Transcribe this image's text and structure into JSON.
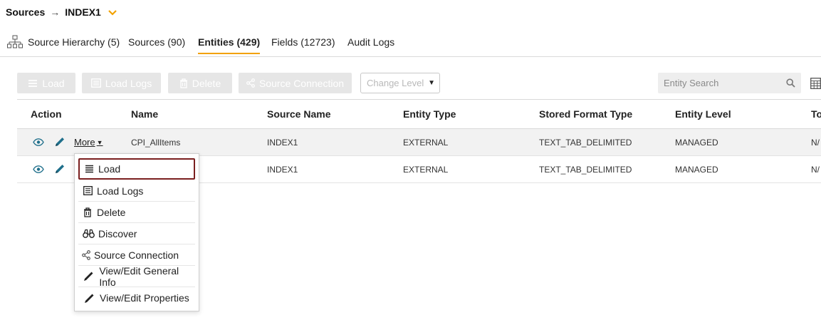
{
  "breadcrumb": {
    "root": "Sources",
    "separator": "→",
    "current": "INDEX1",
    "chevron_icon": "chevron-down-icon",
    "chevron_color": "#f2a100"
  },
  "tabs": [
    {
      "label": "Source Hierarchy (5)",
      "icon": "hierarchy-icon",
      "active": false
    },
    {
      "label": "Sources (90)",
      "active": false
    },
    {
      "label": "Entities (429)",
      "active": true
    },
    {
      "label": "Fields (12723)",
      "active": false
    },
    {
      "label": "Audit Logs",
      "active": false
    }
  ],
  "toolbar": {
    "load": "Load",
    "load_logs": "Load Logs",
    "delete": "Delete",
    "source_connection": "Source Connection",
    "change_level_placeholder": "Change Level",
    "search_placeholder": "Entity Search"
  },
  "table": {
    "columns": [
      "Action",
      "Name",
      "Source Name",
      "Entity Type",
      "Stored Format Type",
      "Entity Level",
      "To"
    ],
    "more_label": "More",
    "rows": [
      {
        "name": "CPI_AllItems",
        "source_name": "INDEX1",
        "entity_type": "EXTERNAL",
        "stored_format_type": "TEXT_TAB_DELIMITED",
        "entity_level": "MANAGED",
        "to": "N/"
      },
      {
        "name": "",
        "source_name": "INDEX1",
        "entity_type": "EXTERNAL",
        "stored_format_type": "TEXT_TAB_DELIMITED",
        "entity_level": "MANAGED",
        "to": "N/"
      }
    ]
  },
  "menu": {
    "items": [
      {
        "label": "Load",
        "icon": "load-icon",
        "highlighted": true
      },
      {
        "label": "Load Logs",
        "icon": "list-icon"
      },
      {
        "label": "Delete",
        "icon": "trash-icon"
      },
      {
        "label": "Discover",
        "icon": "binoculars-icon"
      },
      {
        "label": "Source Connection",
        "icon": "share-icon"
      },
      {
        "label": "View/Edit General Info",
        "icon": "pencil-icon"
      },
      {
        "label": "View/Edit Properties",
        "icon": "pencil-icon"
      }
    ]
  },
  "colors": {
    "accent": "#f2a100",
    "icon_teal": "#1f6f8b",
    "highlight_border": "#7a1f1f",
    "disabled_button": "#e6e6e6"
  }
}
